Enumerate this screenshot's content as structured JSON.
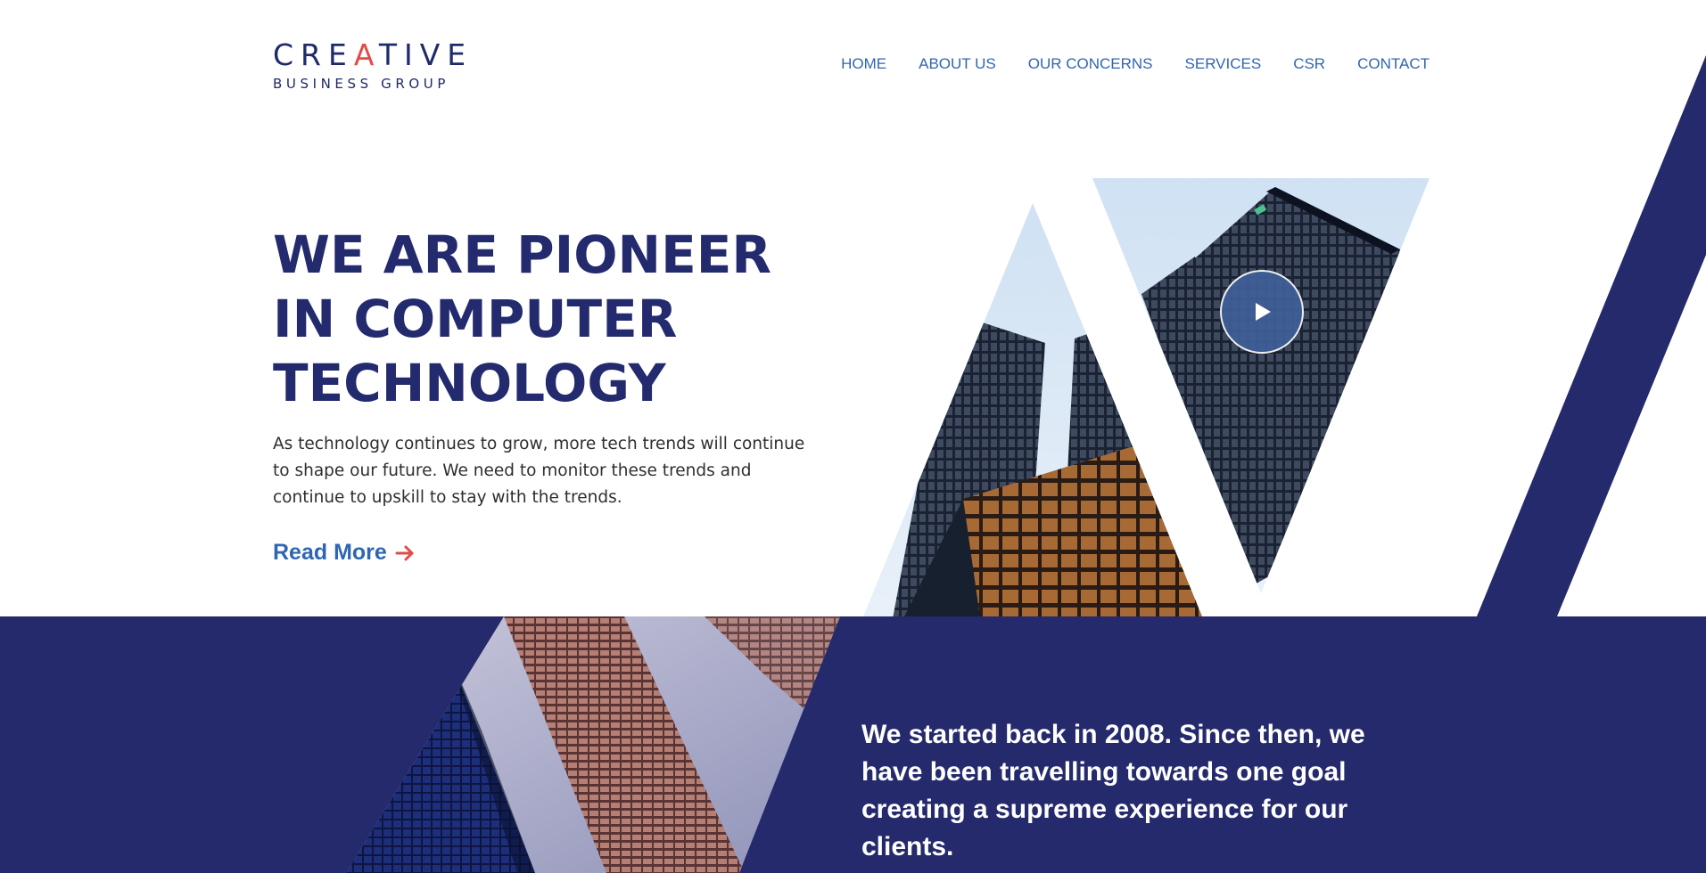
{
  "brand": {
    "logo_line1_before": "CRE",
    "logo_line1_accent": "A",
    "logo_line1_after": "TIVE",
    "logo_line2": "BUSINESS GROUP"
  },
  "nav": {
    "items": [
      {
        "label": "HOME"
      },
      {
        "label": "ABOUT US"
      },
      {
        "label": "OUR CONCERNS"
      },
      {
        "label": "SERVICES"
      },
      {
        "label": "CSR"
      },
      {
        "label": "CONTACT"
      }
    ]
  },
  "hero": {
    "title": "WE ARE PIONEER IN COMPUTER TECHNOLOGY",
    "text": "As technology continues to grow, more tech trends will continue to shape our future. We need to monitor these trends and continue to upskill to stay with the trends.",
    "read_more_label": "Read More",
    "read_more_icon": "arrow-right-icon",
    "video_icon": "play-icon"
  },
  "intro": {
    "text": "We started back in 2008. Since then, we have been travelling towards one goal creating a supreme experience for our clients."
  },
  "colors": {
    "navy": "#242a6b",
    "nav_blue": "#2f66b3",
    "accent_red": "#e24b48",
    "body_text": "#2e2e2e"
  }
}
